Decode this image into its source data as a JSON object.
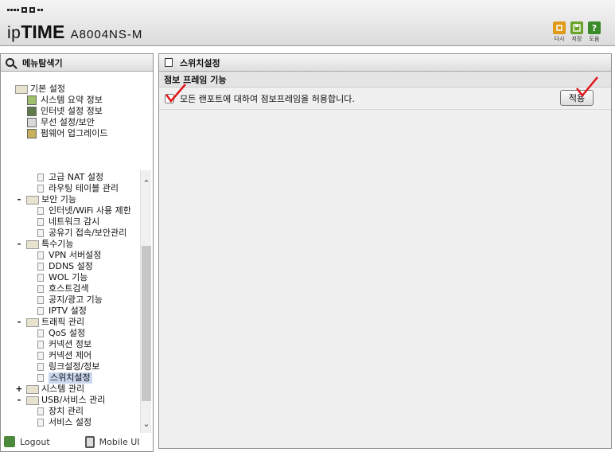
{
  "header": {
    "brand_prefix": "ip",
    "brand_tm": "TIME",
    "model": "A8004NS-M",
    "buttons": [
      {
        "label": "다시",
        "icon": "refresh-icon",
        "color": "#e09a1a"
      },
      {
        "label": "저장",
        "icon": "save-icon",
        "color": "#6aa42b"
      },
      {
        "label": "도움",
        "icon": "help-icon",
        "glyph": "?",
        "color": "#3a8a2a"
      }
    ]
  },
  "left": {
    "title": "메뉴탐색기",
    "tree_top": [
      {
        "label": "기본 설정",
        "type": "folder"
      },
      {
        "label": "시스템 요약 정보",
        "type": "item"
      },
      {
        "label": "인터넷 설정 정보",
        "type": "item"
      },
      {
        "label": "무선 설정/보안",
        "type": "item"
      },
      {
        "label": "펌웨어 업그레이드",
        "type": "item"
      }
    ],
    "tree_scroll": [
      {
        "label": "고급 NAT 설정",
        "type": "page"
      },
      {
        "label": "라우팅 테이블 관리",
        "type": "page"
      },
      {
        "label": "보안 기능",
        "type": "folder",
        "toggle": "-"
      },
      {
        "label": "인터넷/WiFi 사용 제한",
        "type": "page"
      },
      {
        "label": "네트워크 감시",
        "type": "page"
      },
      {
        "label": "공유기 접속/보안관리",
        "type": "page"
      },
      {
        "label": "특수기능",
        "type": "folder",
        "toggle": "-"
      },
      {
        "label": "VPN 서버설정",
        "type": "page"
      },
      {
        "label": "DDNS 설정",
        "type": "page"
      },
      {
        "label": "WOL 기능",
        "type": "page"
      },
      {
        "label": "호스트검색",
        "type": "page"
      },
      {
        "label": "공지/광고 기능",
        "type": "page"
      },
      {
        "label": "IPTV 설정",
        "type": "page"
      },
      {
        "label": "트래픽 관리",
        "type": "folder",
        "toggle": "-"
      },
      {
        "label": "QoS 설정",
        "type": "page"
      },
      {
        "label": "커넥션 정보",
        "type": "page"
      },
      {
        "label": "커넥션 제어",
        "type": "page"
      },
      {
        "label": "링크설정/정보",
        "type": "page"
      },
      {
        "label": "스위치설정",
        "type": "page",
        "selected": true
      },
      {
        "label": "시스템 관리",
        "type": "folder",
        "toggle": "+"
      },
      {
        "label": "USB/서비스 관리",
        "type": "folder",
        "toggle": "-"
      },
      {
        "label": "장치 관리",
        "type": "page"
      },
      {
        "label": "서비스 설정",
        "type": "page"
      }
    ],
    "footer": {
      "logout": "Logout",
      "mobile": "Mobile UI"
    }
  },
  "main": {
    "title": "스위치설정",
    "section": "점보 프레임 기능",
    "option_label": "모든 랜포트에 대하여 점보프레임을 허용합니다.",
    "option_checked": false,
    "apply_label": "적용"
  }
}
